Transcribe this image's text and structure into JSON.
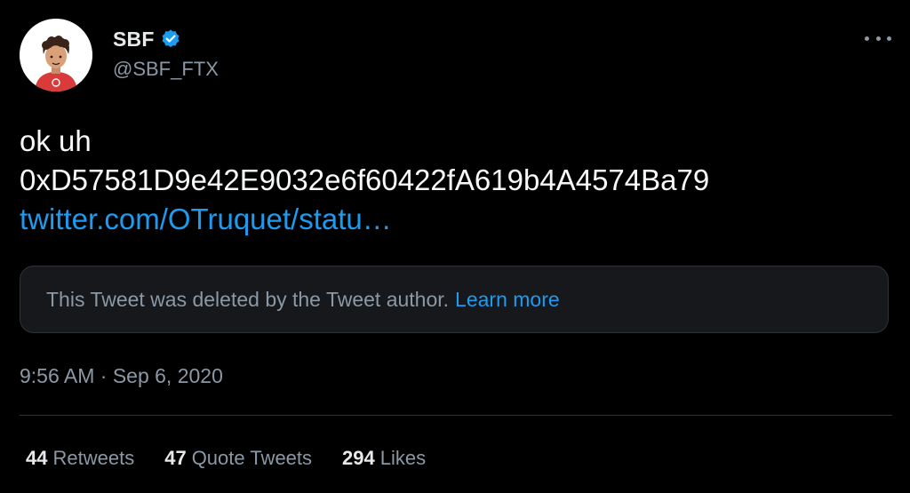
{
  "author": {
    "display_name": "SBF",
    "handle": "@SBF_FTX",
    "verified": true,
    "avatar_icon": "cartoon-avatar-icon"
  },
  "tweet": {
    "text_line1": "ok uh",
    "text_line2": "0xD57581D9e42E9032e6f60422fA619b4A4574Ba79",
    "link_text": "twitter.com/OTruquet/statu…"
  },
  "quoted_tweet": {
    "deleted_message": "This Tweet was deleted by the Tweet author.",
    "learn_more": "Learn more"
  },
  "timestamp": "9:56 AM · Sep 6, 2020",
  "stats": {
    "retweets_count": "44",
    "retweets_label": "Retweets",
    "quote_tweets_count": "47",
    "quote_tweets_label": "Quote Tweets",
    "likes_count": "294",
    "likes_label": "Likes"
  },
  "colors": {
    "background": "#000000",
    "link": "#1d9bf0",
    "muted": "#8b98a5",
    "text": "#e7e9ea"
  }
}
